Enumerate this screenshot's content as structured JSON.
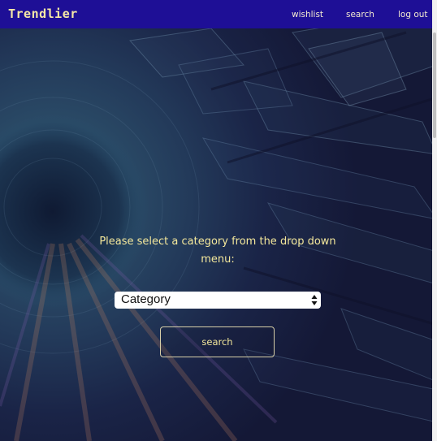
{
  "navbar": {
    "brand": "Trendlier",
    "links": [
      {
        "label": "wishlist"
      },
      {
        "label": "search"
      },
      {
        "label": "log out"
      }
    ]
  },
  "main": {
    "prompt": "Please select a category from the drop down menu:",
    "category_select": {
      "selected": "Category"
    },
    "search_button": "search"
  },
  "colors": {
    "navbar_bg": "#1e0f96",
    "brand_text": "#f6e7a6",
    "accent_text": "#f3e79b",
    "background": "#161a3a"
  },
  "icons": {
    "select_arrows": "up-down-chevron-icon"
  }
}
